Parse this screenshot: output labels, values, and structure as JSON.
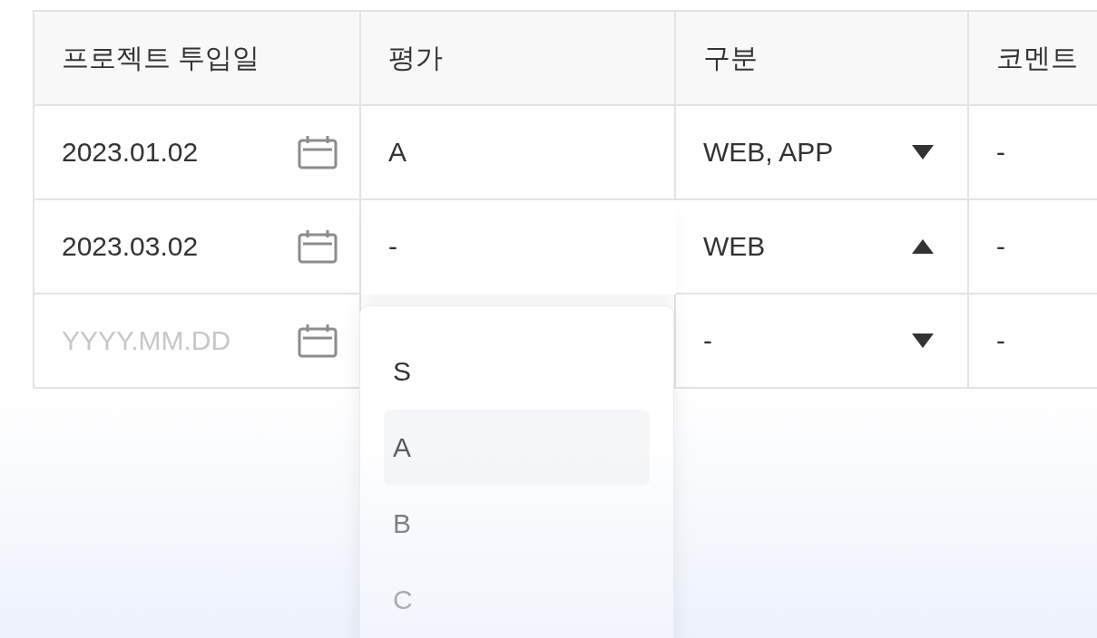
{
  "table": {
    "columns": [
      "프로젝트 투입일",
      "평가",
      "구분",
      "코멘트"
    ],
    "rows": [
      {
        "date": {
          "value": "2023.01.02"
        },
        "grade": {
          "value": "A",
          "open": false
        },
        "type": {
          "value": "WEB, APP",
          "expanded": false
        },
        "comment": "-"
      },
      {
        "date": {
          "value": "2023.03.02"
        },
        "grade": {
          "value": "-",
          "open": true
        },
        "type": {
          "value": "WEB",
          "expanded": true
        },
        "comment": "-"
      },
      {
        "date": {
          "placeholder": "YYYY.MM.DD"
        },
        "grade": {
          "open": false
        },
        "type": {
          "value": "-",
          "expanded": false
        },
        "comment": "-"
      }
    ]
  },
  "grade_dropdown": {
    "options": [
      {
        "label": "S",
        "selected": false
      },
      {
        "label": "A",
        "selected": true
      },
      {
        "label": "B",
        "selected": false
      },
      {
        "label": "C",
        "selected": false
      }
    ]
  }
}
